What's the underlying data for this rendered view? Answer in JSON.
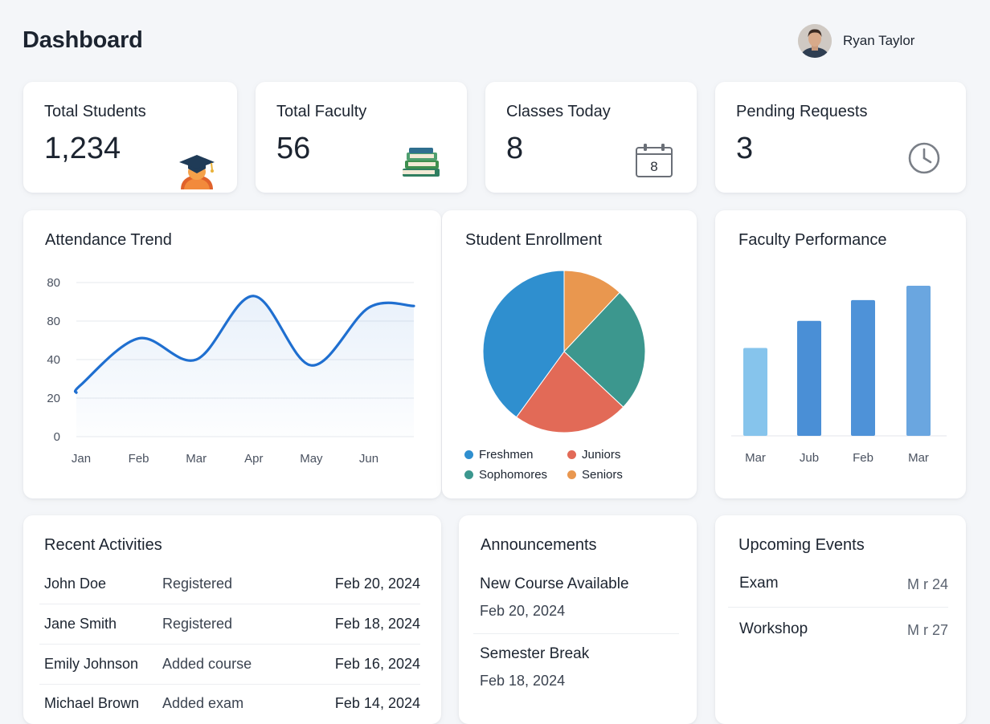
{
  "header": {
    "title": "Dashboard",
    "user_name": "Ryan Taylor"
  },
  "stats": [
    {
      "label": "Total Students",
      "value": "1,234",
      "icon": "graduate-icon"
    },
    {
      "label": "Total Faculty",
      "value": "56",
      "icon": "books-icon"
    },
    {
      "label": "Classes Today",
      "value": "8",
      "icon": "calendar-icon",
      "icon_text": "8"
    },
    {
      "label": "Pending Requests",
      "value": "3",
      "icon": "clock-icon"
    }
  ],
  "attendance": {
    "title": "Attendance Trend"
  },
  "enrollment": {
    "title": "Student Enrollment"
  },
  "performance": {
    "title": "Faculty Performance"
  },
  "chart_data": [
    {
      "type": "area",
      "title": "Attendance Trend",
      "categories": [
        "Jan",
        "Feb",
        "Mar",
        "Apr",
        "May",
        "Jun"
      ],
      "y_tick_labels": [
        "0",
        "20",
        "40",
        "80",
        "80"
      ],
      "values": [
        27,
        51,
        40,
        73,
        37,
        67
      ],
      "ylim": [
        0,
        80
      ],
      "grid": true,
      "color": "#1f6fd0"
    },
    {
      "type": "pie",
      "title": "Student Enrollment",
      "series": [
        {
          "name": "Freshmen",
          "value": 40,
          "color": "#2f8fcf"
        },
        {
          "name": "Juniors",
          "value": 23,
          "color": "#e26a57"
        },
        {
          "name": "Sophomores",
          "value": 25,
          "color": "#3c978e"
        },
        {
          "name": "Seniors",
          "value": 12,
          "color": "#e9974f"
        }
      ],
      "legend_position": "bottom"
    },
    {
      "type": "bar",
      "title": "Faculty Performance",
      "categories": [
        "Mar",
        "Jub",
        "Feb",
        "Mar"
      ],
      "values": [
        55,
        72,
        85,
        94
      ],
      "ylim": [
        0,
        100
      ],
      "colors": [
        "#86c4ec",
        "#4a8fd6",
        "#4e92d8",
        "#6aa6e0"
      ]
    }
  ],
  "recent_activities": {
    "title": "Recent Activities",
    "rows": [
      {
        "name": "John Doe",
        "action": "Registered",
        "date": "Feb 20, 2024"
      },
      {
        "name": "Jane Smith",
        "action": "Registered",
        "date": "Feb 18, 2024"
      },
      {
        "name": "Emily Johnson",
        "action": "Added course",
        "date": "Feb 16, 2024"
      },
      {
        "name": "Michael Brown",
        "action": "Added exam",
        "date": "Feb 14, 2024"
      }
    ]
  },
  "announcements": {
    "title": "Announcements",
    "items": [
      {
        "title": "New Course Available",
        "date": "Feb 20, 2024"
      },
      {
        "title": "Semester Break",
        "date": "Feb 18, 2024"
      }
    ]
  },
  "events": {
    "title": "Upcoming Events",
    "items": [
      {
        "name": "Exam",
        "date": "M r 24"
      },
      {
        "name": "Workshop",
        "date": "M r 27"
      }
    ]
  }
}
